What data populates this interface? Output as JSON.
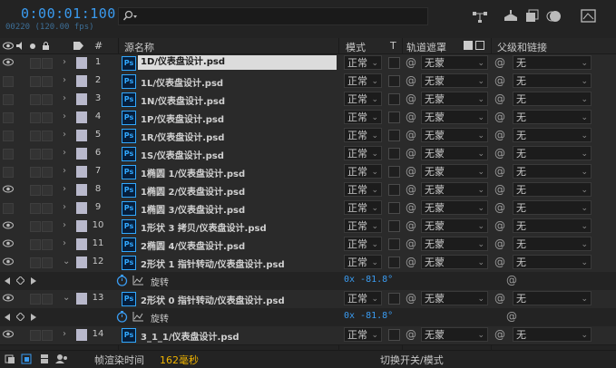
{
  "timecode": "0:00:01:100",
  "frame_info": "00220 (120.00 fps)",
  "search": {
    "placeholder": ""
  },
  "header": {
    "number": "#",
    "source_name": "源名称",
    "mode": "模式",
    "t": "T",
    "track_matte": "轨道遮罩",
    "parent_link": "父级和链接"
  },
  "layers": [
    {
      "type": "layer",
      "num": "1",
      "name": "1D/仪表盘设计.psd",
      "mode": "正常",
      "matte": "无蒙",
      "parent": "无",
      "eye": true,
      "selected": true,
      "twirl": "›"
    },
    {
      "type": "layer",
      "num": "2",
      "name": "1L/仪表盘设计.psd",
      "mode": "正常",
      "matte": "无蒙",
      "parent": "无",
      "eye": false,
      "twirl": "›"
    },
    {
      "type": "layer",
      "num": "3",
      "name": "1N/仪表盘设计.psd",
      "mode": "正常",
      "matte": "无蒙",
      "parent": "无",
      "eye": false,
      "twirl": "›"
    },
    {
      "type": "layer",
      "num": "4",
      "name": "1P/仪表盘设计.psd",
      "mode": "正常",
      "matte": "无蒙",
      "parent": "无",
      "eye": false,
      "twirl": "›"
    },
    {
      "type": "layer",
      "num": "5",
      "name": "1R/仪表盘设计.psd",
      "mode": "正常",
      "matte": "无蒙",
      "parent": "无",
      "eye": false,
      "twirl": "›"
    },
    {
      "type": "layer",
      "num": "6",
      "name": "1S/仪表盘设计.psd",
      "mode": "正常",
      "matte": "无蒙",
      "parent": "无",
      "eye": false,
      "twirl": "›"
    },
    {
      "type": "layer",
      "num": "7",
      "name": "1椭圆 1/仪表盘设计.psd",
      "mode": "正常",
      "matte": "无蒙",
      "parent": "无",
      "eye": false,
      "twirl": "›"
    },
    {
      "type": "layer",
      "num": "8",
      "name": "1椭圆 2/仪表盘设计.psd",
      "mode": "正常",
      "matte": "无蒙",
      "parent": "无",
      "eye": true,
      "twirl": "›"
    },
    {
      "type": "layer",
      "num": "9",
      "name": "1椭圆 3/仪表盘设计.psd",
      "mode": "正常",
      "matte": "无蒙",
      "parent": "无",
      "eye": false,
      "twirl": "›"
    },
    {
      "type": "layer",
      "num": "10",
      "name": "1形状 3 拷贝/仪表盘设计.psd",
      "mode": "正常",
      "matte": "无蒙",
      "parent": "无",
      "eye": true,
      "twirl": "›"
    },
    {
      "type": "layer",
      "num": "11",
      "name": "2椭圆 4/仪表盘设计.psd",
      "mode": "正常",
      "matte": "无蒙",
      "parent": "无",
      "eye": true,
      "twirl": "›"
    },
    {
      "type": "layer",
      "num": "12",
      "name": "2形状 1 指针转动/仪表盘设计.psd",
      "mode": "正常",
      "matte": "无蒙",
      "parent": "无",
      "eye": true,
      "twirl": "⌄"
    },
    {
      "type": "prop",
      "name": "旋转",
      "value": "0x -81.8°"
    },
    {
      "type": "layer",
      "num": "13",
      "name": "2形状 0 指针转动/仪表盘设计.psd",
      "mode": "正常",
      "matte": "无蒙",
      "parent": "无",
      "eye": true,
      "twirl": "⌄"
    },
    {
      "type": "prop",
      "name": "旋转",
      "value": "0x -81.8°"
    },
    {
      "type": "layer",
      "num": "14",
      "name": "3_1_1/仪表盘设计.psd",
      "mode": "正常",
      "matte": "无蒙",
      "parent": "无",
      "eye": true,
      "twirl": "›"
    }
  ],
  "bottom": {
    "render_label": "帧渲染时间",
    "render_value": "162毫秒",
    "toggle_label": "切换开关/模式"
  },
  "colors": {
    "accent": "#3a9bf0",
    "label": "#b9b9cc",
    "ps": "#31a8ff"
  }
}
